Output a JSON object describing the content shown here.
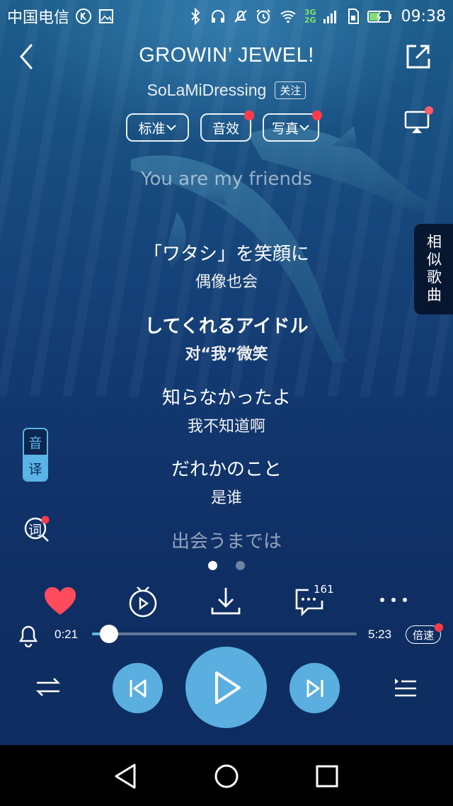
{
  "status_bar": {
    "carrier": "中国电信",
    "network": [
      "3G",
      "2G"
    ],
    "time": "09:38"
  },
  "header": {
    "title": "GROWIN’ JEWEL!",
    "artist": "SoLaMiDressing",
    "follow_label": "关注",
    "pills": [
      {
        "label": "标准",
        "has_dropdown": true,
        "red_dot": false
      },
      {
        "label": "音效",
        "has_dropdown": false,
        "red_dot": true
      },
      {
        "label": "写真",
        "has_dropdown": true,
        "red_dot": true
      }
    ]
  },
  "lyrics": [
    {
      "jp": "You are my friends",
      "cn": "",
      "state": "past"
    },
    {
      "jp": "「ワタシ」を笑顔に",
      "cn": "偶像也会",
      "state": "normal"
    },
    {
      "jp": "してくれるアイドル",
      "cn": "对“我”微笑",
      "state": "current"
    },
    {
      "jp": "知らなかったよ",
      "cn": "我不知道啊",
      "state": "normal"
    },
    {
      "jp": "だれかのこと",
      "cn": "是谁",
      "state": "normal"
    },
    {
      "jp": "出会うまでは",
      "cn": "",
      "state": "faded"
    }
  ],
  "side": {
    "similar_songs_label": "相似歌曲",
    "translate_top": "音",
    "translate_bottom": "译",
    "lyric_search_label": "词"
  },
  "pager": {
    "count": 2,
    "active": 0
  },
  "actions": {
    "comment_count": "161"
  },
  "progress": {
    "current": "0:21",
    "total": "5:23",
    "fraction": 0.065,
    "speed_label": "倍速"
  },
  "colors": {
    "accent": "#5aaee0",
    "heart": "#ff4b5c",
    "red_dot": "#ff3b4a"
  },
  "icons": {
    "back": "chevron-left-icon",
    "share": "share-icon",
    "cast": "cast-icon",
    "like": "heart-icon",
    "video": "tv-play-icon",
    "download": "download-icon",
    "comment": "comment-icon",
    "more": "more-dots-icon",
    "timer": "bell-icon",
    "mode": "shuffle-icon",
    "prev": "previous-icon",
    "play": "play-icon",
    "next": "next-icon",
    "playlist": "playlist-icon"
  }
}
